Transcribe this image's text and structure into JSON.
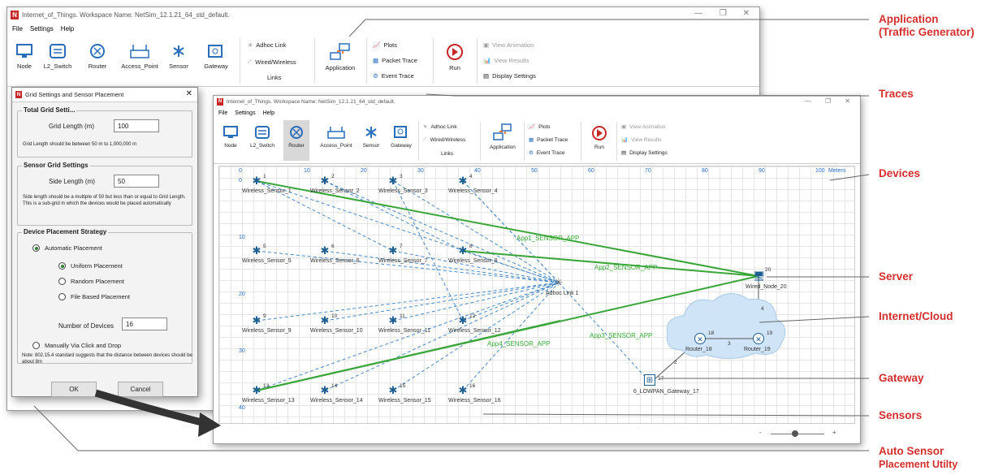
{
  "back_window": {
    "title": "Internet_of_Things. Workspace Name: NetSim_12.1.21_64_std_default.",
    "menu": [
      "File",
      "Settings",
      "Help"
    ],
    "ribbon": {
      "node": "Node",
      "l2": "L2_Switch",
      "router": "Router",
      "ap": "Access_Point",
      "sensor": "Sensor",
      "gateway": "Gateway",
      "adhoc": "Adhoc Link",
      "wired": "Wired/Wireless",
      "links": "Links",
      "application": "Application",
      "plots": "Plots",
      "packet_trace": "Packet Trace",
      "event_trace": "Event Trace",
      "run": "Run",
      "view_anim": "View Animation",
      "view_results": "View Results",
      "display": "Display Settings"
    }
  },
  "front_window": {
    "title": "Internet_of_Things. Workspace Name: NetSim_12.1.21_64_std_default.",
    "menu": [
      "File",
      "Settings",
      "Help"
    ],
    "ribbon": {
      "node": "Node",
      "l2": "L2_Switch",
      "router": "Router",
      "ap": "Access_Point",
      "sensor": "Sensor",
      "gateway": "Gateway",
      "adhoc": "Adhoc Link",
      "wired": "Wired/Wireless",
      "links": "Links",
      "application": "Application",
      "plots": "Plots",
      "packet_trace": "Packet Trace",
      "event_trace": "Event Trace",
      "run": "Run",
      "view_anim": "View Animation",
      "view_results": "View Results",
      "display": "Display Settings"
    },
    "ruler_top": [
      "0",
      "10",
      "20",
      "30",
      "40",
      "50",
      "60",
      "70",
      "80",
      "90",
      "100"
    ],
    "ruler_unit": "Meters",
    "ruler_left": [
      "0",
      "10",
      "20",
      "30",
      "40"
    ],
    "devices": [
      {
        "num": "1",
        "label": "Wireless_Sensor_1"
      },
      {
        "num": "2",
        "label": "Wireless_Sensor_2"
      },
      {
        "num": "3",
        "label": "Wireless_Sensor_3"
      },
      {
        "num": "4",
        "label": "Wireless_Sensor_4"
      },
      {
        "num": "5",
        "label": "Wireless_Sensor_5"
      },
      {
        "num": "6",
        "label": "Wireless_Sensor_6"
      },
      {
        "num": "7",
        "label": "Wireless_Sensor_7"
      },
      {
        "num": "8",
        "label": "Wireless_Sensor_8"
      },
      {
        "num": "9",
        "label": "Wireless_Sensor_9"
      },
      {
        "num": "10",
        "label": "Wireless_Sensor_10"
      },
      {
        "num": "11",
        "label": "Wireless_Sensor_11"
      },
      {
        "num": "12",
        "label": "Wireless_Sensor_12"
      },
      {
        "num": "13",
        "label": "Wireless_Sensor_13"
      },
      {
        "num": "14",
        "label": "Wireless_Sensor_14"
      },
      {
        "num": "15",
        "label": "Wireless_Sensor_15"
      },
      {
        "num": "16",
        "label": "Wireless_Sensor_16"
      }
    ],
    "adhoc_label": "Adhoc Link 1",
    "server": {
      "num": "20",
      "label": "Wired_Node_20"
    },
    "router18": {
      "num": "18",
      "label": "Router_18"
    },
    "router19": {
      "num": "19",
      "label": "Router_19"
    },
    "gateway": {
      "num": "17",
      "label": "6_LOWPAN_Gateway_17"
    },
    "link_labels": [
      "4",
      "3",
      "2"
    ],
    "apps": [
      "App1_SENSOR_APP",
      "App2_SENSOR_APP",
      "App3_SENSOR_APP",
      "App4_SENSOR_APP"
    ],
    "zoom_minus": "-",
    "zoom_plus": "+"
  },
  "dialog": {
    "title": "Grid Settings and Sensor Placement",
    "total_legend": "Total Grid Setti...",
    "grid_length_label": "Grid Length (m)",
    "grid_length_value": "100",
    "grid_note": "Grid Length should be between 50 m to 1,000,000 m",
    "sensor_legend": "Sensor Grid Settings",
    "side_length_label": "Side Length (m)",
    "side_length_value": "50",
    "side_note": "Side length should be a multiple of 50 but less than or equal to Grid Length. This is a sub-grid in which the devices would be placed automatically",
    "strategy_legend": "Device Placement Strategy",
    "auto": "Automatic Placement",
    "uniform": "Uniform Placement",
    "random": "Random Placement",
    "file": "File Based Placement",
    "num_devices_label": "Number of Devices",
    "num_devices_value": "16",
    "manual": "Manually Via Click and Drop",
    "footer_note": "Note: 802.15.4 standard suggests that the distance between devices should be about 8m",
    "ok": "OK",
    "cancel": "Cancel"
  },
  "callouts": {
    "application": "Application",
    "traffic": "(Traffic Generator)",
    "traces": "Traces",
    "devices": "Devices",
    "server": "Server",
    "internet": "Internet/Cloud",
    "gateway": "Gateway",
    "sensors": "Sensors",
    "auto1": "Auto Sensor",
    "auto2": "Placement Utilty"
  },
  "colors": {
    "callout": "#d32f2f",
    "app_line": "#3aa63a",
    "wireless_line": "#4a8ac4"
  }
}
